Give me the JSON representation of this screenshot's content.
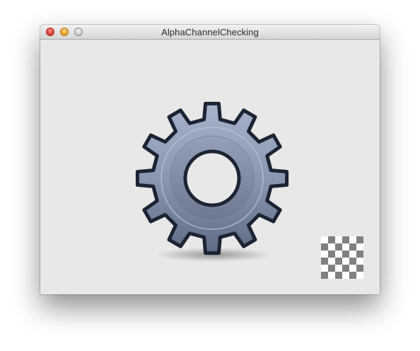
{
  "window": {
    "title": "AlphaChannelChecking"
  },
  "icons": {
    "gear": "gear-icon",
    "transparency_checker": "transparency-checkerboard-icon"
  },
  "colors": {
    "gear_fill": "#8c9ab2",
    "gear_outline": "#1c2333",
    "window_background": "#e8e8e8",
    "checker_dark": "#808080",
    "checker_light": "#ffffff"
  }
}
